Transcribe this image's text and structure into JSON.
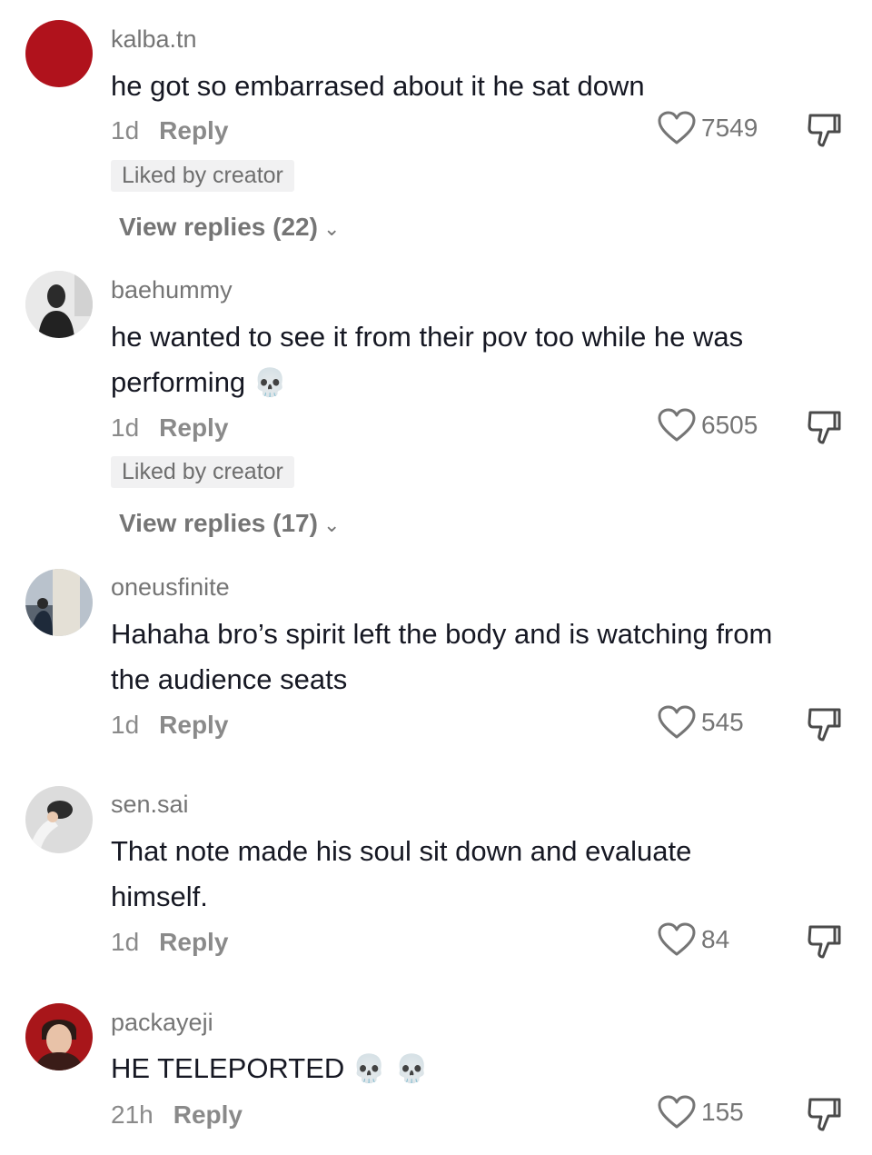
{
  "comments": [
    {
      "username": "kalba.tn",
      "text": "he got so embarrased about it he sat down",
      "time": "1d",
      "reply_label": "Reply",
      "likes": "7549",
      "liked_by_creator": "Liked by creator",
      "view_replies": "View replies (22)",
      "avatar_color": "#b0121c"
    },
    {
      "username": "baehummy",
      "text_line1": "he wanted to see it from their pov too while he was",
      "text_line2": "performing",
      "emoji": "💀",
      "time": "1d",
      "reply_label": "Reply",
      "likes": "6505",
      "liked_by_creator": "Liked by creator",
      "view_replies": "View replies (17)"
    },
    {
      "username": "oneusfinite",
      "text_line1": "Hahaha bro’s spirit left the body and is watching from",
      "text_line2": "the audience seats",
      "time": "1d",
      "reply_label": "Reply",
      "likes": "545"
    },
    {
      "username": "sen.sai",
      "text_line1": "That note made his soul sit down and evaluate",
      "text_line2": "himself.",
      "time": "1d",
      "reply_label": "Reply",
      "likes": "84"
    },
    {
      "username": "packayeji",
      "text": "HE TELEPORTED",
      "emoji": "💀 💀",
      "time": "21h",
      "reply_label": "Reply",
      "likes": "155"
    }
  ],
  "icons": {
    "like": "heart-outline-icon",
    "dislike": "thumbs-down-outline-icon",
    "chevron": "chevron-down-icon"
  }
}
